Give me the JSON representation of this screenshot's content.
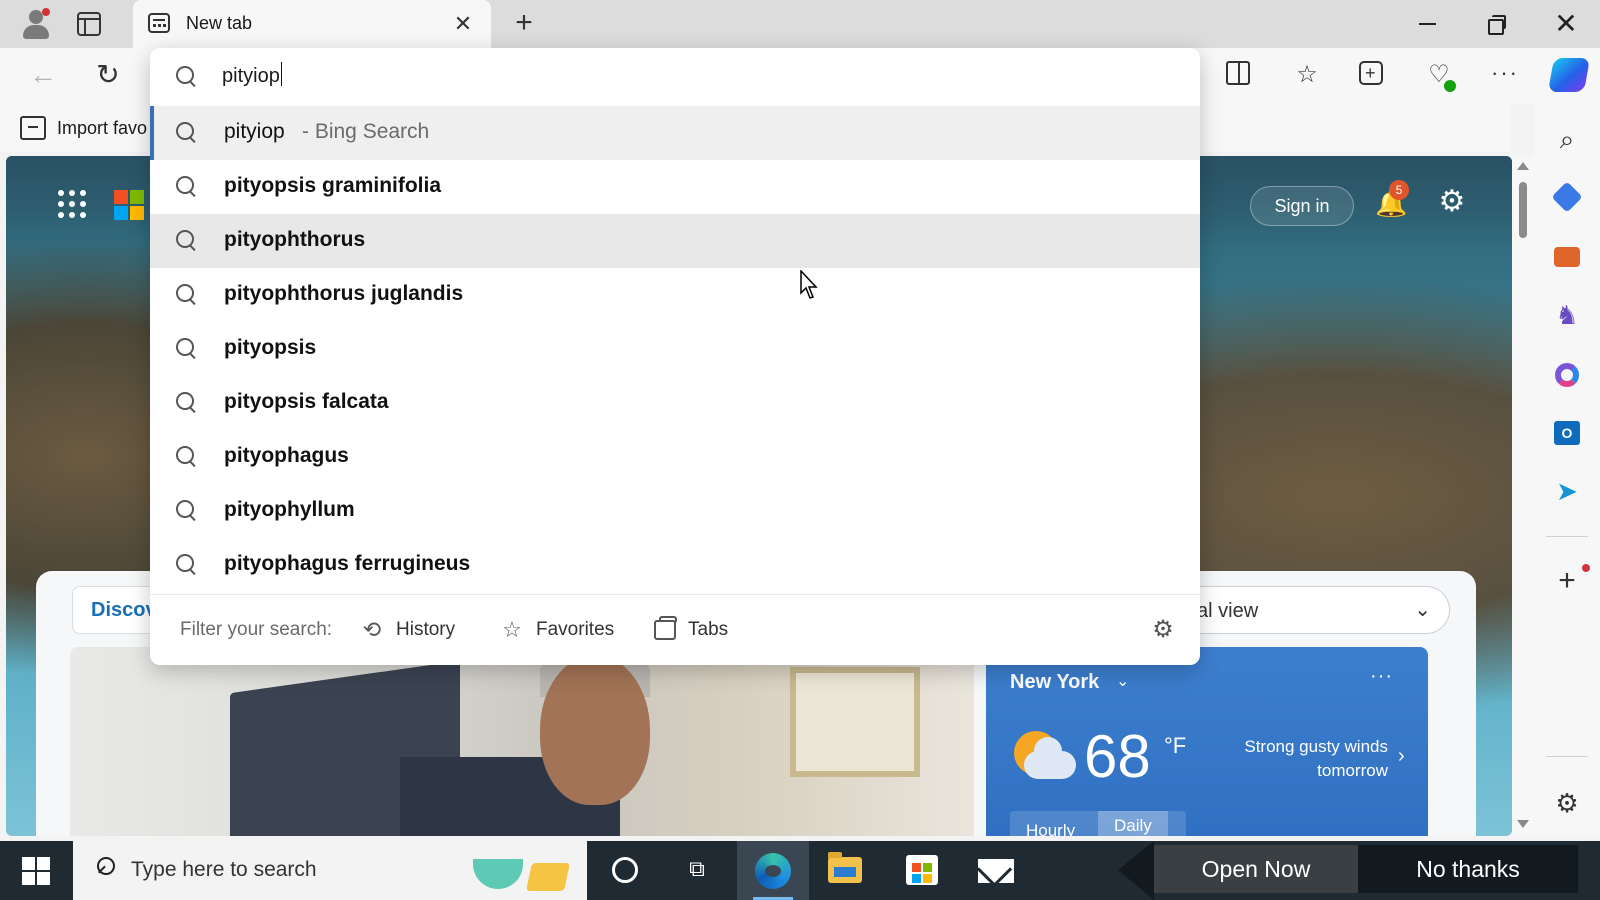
{
  "browser": {
    "tab_title": "New tab",
    "tab_close_glyph": "✕",
    "new_tab_glyph": "+",
    "window_close_glyph": "✕"
  },
  "toolbar": {
    "back_glyph": "←",
    "reload_glyph": "↻",
    "favorites_glyph": "☆",
    "health_glyph": "♡",
    "more_glyph": "···"
  },
  "favorites_bar": {
    "import_label": "Import favo"
  },
  "omnibox": {
    "query": "pityiop",
    "suggestions": [
      {
        "text": "pityiop",
        "suffix": " - Bing Search"
      },
      {
        "text": "pityopsis graminifolia"
      },
      {
        "text": "pityophthorus"
      },
      {
        "text": "pityophthorus juglandis"
      },
      {
        "text": "pityopsis"
      },
      {
        "text": "pityopsis falcata"
      },
      {
        "text": "pityophagus"
      },
      {
        "text": "pityophyllum"
      },
      {
        "text": "pityophagus ferrugineus"
      }
    ],
    "filter_label": "Filter your search:",
    "filters": {
      "history": "History",
      "favorites": "Favorites",
      "tabs": "Tabs"
    },
    "history_glyph": "⟲",
    "favorites_glyph": "☆",
    "gear_glyph": "⚙"
  },
  "newtab": {
    "sign_in": "Sign in",
    "notification_count": "5",
    "bell_glyph": "🔔",
    "gear_glyph": "⚙",
    "discover_label": "Discove",
    "view_select": "tial view",
    "view_chevron": "⌄"
  },
  "weather": {
    "city": "New York",
    "city_chevron": "⌄",
    "more": "···",
    "temperature": "68",
    "unit": "°F",
    "forecast": "Strong gusty winds tomorrow",
    "next": "›",
    "tabs": {
      "hourly": "Hourly",
      "daily": "Daily"
    }
  },
  "sidebar": {
    "search_glyph": "⌕",
    "games_glyph": "♞",
    "send_glyph": "➤",
    "outlook_letter": "O",
    "add_glyph": "+",
    "settings_glyph": "⚙"
  },
  "taskbar": {
    "search_placeholder": "Type here to search",
    "taskview_glyph": "⧉"
  },
  "ad_banner": {
    "open_now": "Open Now",
    "no_thanks": "No thanks"
  },
  "colors": {
    "accent": "#3a6fb8",
    "badge": "#e0562a",
    "taskbar": "#1f2a33"
  }
}
